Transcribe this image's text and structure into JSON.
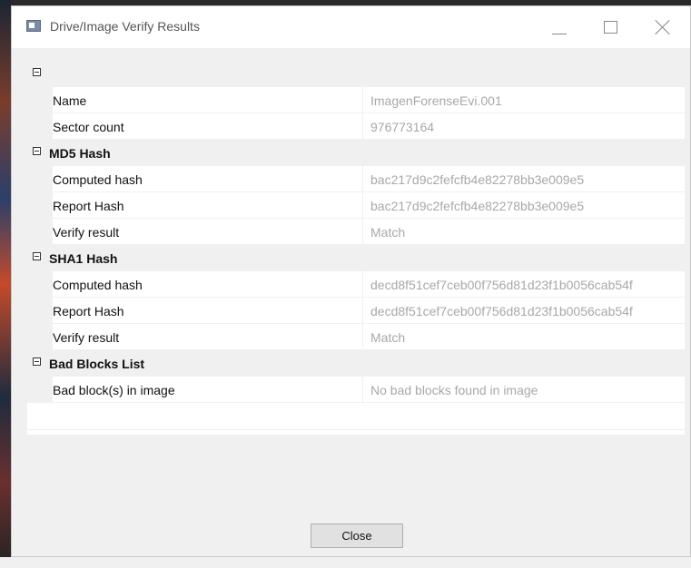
{
  "window": {
    "title": "Drive/Image Verify Results"
  },
  "titlebar_icons": [
    "app-icon",
    "minimize-icon",
    "maximize-icon",
    "close-icon"
  ],
  "grid": {
    "general": {
      "label": "",
      "rows": [
        {
          "name": "Name",
          "value": "ImagenForenseEvi.001"
        },
        {
          "name": "Sector count",
          "value": "976773164"
        }
      ]
    },
    "md5": {
      "label": "MD5 Hash",
      "rows": [
        {
          "name": "Computed hash",
          "value": "bac217d9c2fefcfb4e82278bb3e009e5"
        },
        {
          "name": "Report Hash",
          "value": "bac217d9c2fefcfb4e82278bb3e009e5"
        },
        {
          "name": "Verify result",
          "value": "Match"
        }
      ]
    },
    "sha1": {
      "label": "SHA1 Hash",
      "rows": [
        {
          "name": "Computed hash",
          "value": "decd8f51cef7ceb00f756d81d23f1b0056cab54f"
        },
        {
          "name": "Report Hash",
          "value": "decd8f51cef7ceb00f756d81d23f1b0056cab54f"
        },
        {
          "name": "Verify result",
          "value": "Match"
        }
      ]
    },
    "badblocks": {
      "label": "Bad Blocks List",
      "rows": [
        {
          "name": "Bad block(s) in image",
          "value": "No bad blocks found in image"
        }
      ]
    }
  },
  "footer": {
    "close_label": "Close"
  },
  "colors": {
    "window_bg": "#f0f0f0",
    "grid_bg": "#ffffff",
    "value_text": "#a8a8a8",
    "name_text": "#111111"
  }
}
